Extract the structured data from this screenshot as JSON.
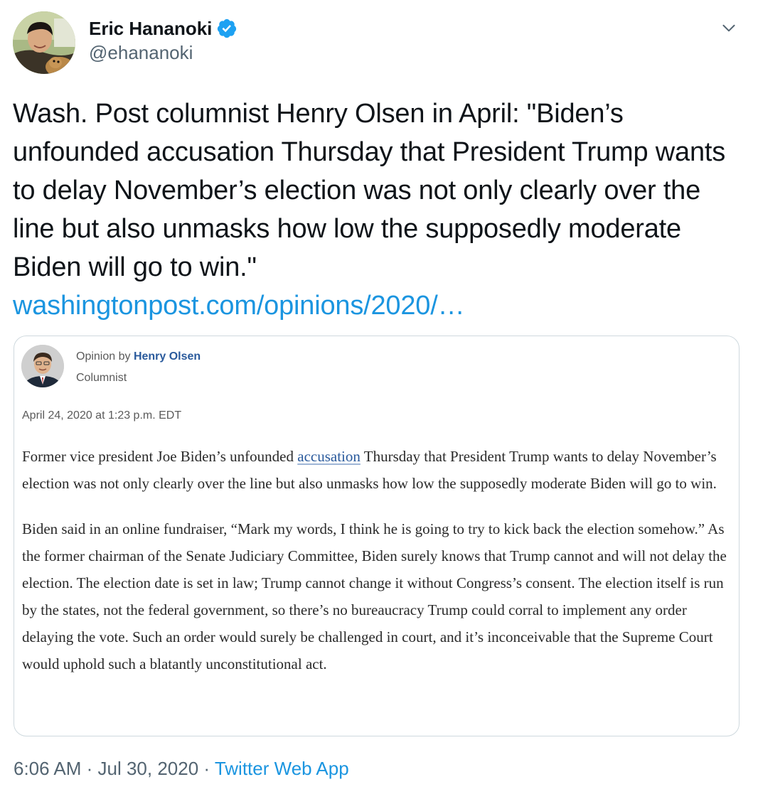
{
  "user": {
    "display_name": "Eric Hananoki",
    "handle": "@ehananoki",
    "verified": true
  },
  "tweet": {
    "text": "Wash. Post columnist Henry Olsen in April: \"Biden’s unfounded accusation Thursday that President Trump wants to delay November’s election was not only clearly over the line but also unmasks how low the supposedly moderate Biden will go to win.\"",
    "link_text": "washingtonpost.com/opinions/2020/…"
  },
  "card": {
    "opinion_prefix": "Opinion by ",
    "author_name": "Henry Olsen",
    "author_role": "Columnist",
    "date": "April 24, 2020 at 1:23 p.m. EDT",
    "para1_before": "Former vice president Joe Biden’s unfounded ",
    "para1_link": "accusation",
    "para1_after": " Thursday that President Trump wants to delay November’s election was not only clearly over the line but also unmasks how low the supposedly moderate Biden will go to win.",
    "para2": "Biden said in an online fundraiser, “Mark my words, I think he is going to try to kick back the election somehow.” As the former chairman of the Senate Judiciary Committee, Biden surely knows that Trump cannot and will not delay the election. The election date is set in law; Trump cannot change it without Congress’s consent. The election itself is run by the states, not the federal government, so there’s no bureaucracy Trump could corral to implement any order delaying the vote. Such an order would surely be challenged in court, and it’s inconceivable that the Supreme Court would uphold such a blatantly unconstitutional act."
  },
  "footer": {
    "time": "6:06 AM",
    "sep1": " · ",
    "date": "Jul 30, 2020",
    "sep2": " · ",
    "source": "Twitter Web App"
  },
  "icons": {
    "verified": "verified-badge-icon",
    "caret": "chevron-down-icon"
  },
  "colors": {
    "link": "#1b95e0",
    "verified": "#1da1f2",
    "secondary_text": "#536471",
    "card_border": "#cfd9de",
    "wapo_link": "#2a5a9c"
  }
}
